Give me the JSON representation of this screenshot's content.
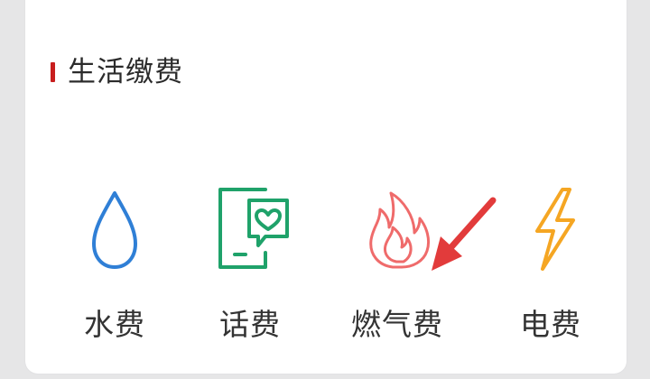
{
  "section": {
    "title": "生活缴费",
    "accent_color": "#c81e1e"
  },
  "items": [
    {
      "label": "水费",
      "icon": "water-drop-icon",
      "color": "#2f7fd6"
    },
    {
      "label": "话费",
      "icon": "phone-heart-icon",
      "color": "#1fa26a"
    },
    {
      "label": "燃气费",
      "icon": "flame-icon",
      "color": "#ef6b6b"
    },
    {
      "label": "电费",
      "icon": "lightning-icon",
      "color": "#f5a623"
    }
  ],
  "annotation": {
    "icon": "red-arrow-icon",
    "color": "#e23b3b"
  }
}
